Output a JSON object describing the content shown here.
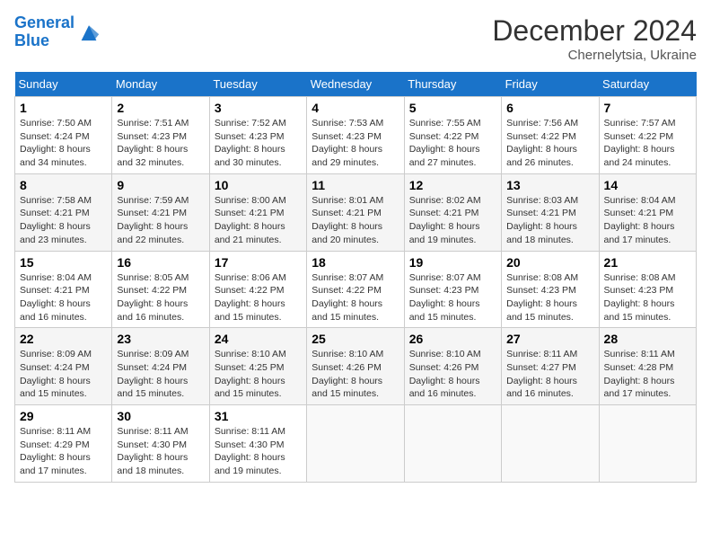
{
  "logo": {
    "line1": "General",
    "line2": "Blue"
  },
  "title": "December 2024",
  "location": "Chernelytsia, Ukraine",
  "days_of_week": [
    "Sunday",
    "Monday",
    "Tuesday",
    "Wednesday",
    "Thursday",
    "Friday",
    "Saturday"
  ],
  "weeks": [
    [
      {
        "day": 1,
        "sunrise": "7:50 AM",
        "sunset": "4:24 PM",
        "daylight": "8 hours and 34 minutes."
      },
      {
        "day": 2,
        "sunrise": "7:51 AM",
        "sunset": "4:23 PM",
        "daylight": "8 hours and 32 minutes."
      },
      {
        "day": 3,
        "sunrise": "7:52 AM",
        "sunset": "4:23 PM",
        "daylight": "8 hours and 30 minutes."
      },
      {
        "day": 4,
        "sunrise": "7:53 AM",
        "sunset": "4:23 PM",
        "daylight": "8 hours and 29 minutes."
      },
      {
        "day": 5,
        "sunrise": "7:55 AM",
        "sunset": "4:22 PM",
        "daylight": "8 hours and 27 minutes."
      },
      {
        "day": 6,
        "sunrise": "7:56 AM",
        "sunset": "4:22 PM",
        "daylight": "8 hours and 26 minutes."
      },
      {
        "day": 7,
        "sunrise": "7:57 AM",
        "sunset": "4:22 PM",
        "daylight": "8 hours and 24 minutes."
      }
    ],
    [
      {
        "day": 8,
        "sunrise": "7:58 AM",
        "sunset": "4:21 PM",
        "daylight": "8 hours and 23 minutes."
      },
      {
        "day": 9,
        "sunrise": "7:59 AM",
        "sunset": "4:21 PM",
        "daylight": "8 hours and 22 minutes."
      },
      {
        "day": 10,
        "sunrise": "8:00 AM",
        "sunset": "4:21 PM",
        "daylight": "8 hours and 21 minutes."
      },
      {
        "day": 11,
        "sunrise": "8:01 AM",
        "sunset": "4:21 PM",
        "daylight": "8 hours and 20 minutes."
      },
      {
        "day": 12,
        "sunrise": "8:02 AM",
        "sunset": "4:21 PM",
        "daylight": "8 hours and 19 minutes."
      },
      {
        "day": 13,
        "sunrise": "8:03 AM",
        "sunset": "4:21 PM",
        "daylight": "8 hours and 18 minutes."
      },
      {
        "day": 14,
        "sunrise": "8:04 AM",
        "sunset": "4:21 PM",
        "daylight": "8 hours and 17 minutes."
      }
    ],
    [
      {
        "day": 15,
        "sunrise": "8:04 AM",
        "sunset": "4:21 PM",
        "daylight": "8 hours and 16 minutes."
      },
      {
        "day": 16,
        "sunrise": "8:05 AM",
        "sunset": "4:22 PM",
        "daylight": "8 hours and 16 minutes."
      },
      {
        "day": 17,
        "sunrise": "8:06 AM",
        "sunset": "4:22 PM",
        "daylight": "8 hours and 15 minutes."
      },
      {
        "day": 18,
        "sunrise": "8:07 AM",
        "sunset": "4:22 PM",
        "daylight": "8 hours and 15 minutes."
      },
      {
        "day": 19,
        "sunrise": "8:07 AM",
        "sunset": "4:23 PM",
        "daylight": "8 hours and 15 minutes."
      },
      {
        "day": 20,
        "sunrise": "8:08 AM",
        "sunset": "4:23 PM",
        "daylight": "8 hours and 15 minutes."
      },
      {
        "day": 21,
        "sunrise": "8:08 AM",
        "sunset": "4:23 PM",
        "daylight": "8 hours and 15 minutes."
      }
    ],
    [
      {
        "day": 22,
        "sunrise": "8:09 AM",
        "sunset": "4:24 PM",
        "daylight": "8 hours and 15 minutes."
      },
      {
        "day": 23,
        "sunrise": "8:09 AM",
        "sunset": "4:24 PM",
        "daylight": "8 hours and 15 minutes."
      },
      {
        "day": 24,
        "sunrise": "8:10 AM",
        "sunset": "4:25 PM",
        "daylight": "8 hours and 15 minutes."
      },
      {
        "day": 25,
        "sunrise": "8:10 AM",
        "sunset": "4:26 PM",
        "daylight": "8 hours and 15 minutes."
      },
      {
        "day": 26,
        "sunrise": "8:10 AM",
        "sunset": "4:26 PM",
        "daylight": "8 hours and 16 minutes."
      },
      {
        "day": 27,
        "sunrise": "8:11 AM",
        "sunset": "4:27 PM",
        "daylight": "8 hours and 16 minutes."
      },
      {
        "day": 28,
        "sunrise": "8:11 AM",
        "sunset": "4:28 PM",
        "daylight": "8 hours and 17 minutes."
      }
    ],
    [
      {
        "day": 29,
        "sunrise": "8:11 AM",
        "sunset": "4:29 PM",
        "daylight": "8 hours and 17 minutes."
      },
      {
        "day": 30,
        "sunrise": "8:11 AM",
        "sunset": "4:30 PM",
        "daylight": "8 hours and 18 minutes."
      },
      {
        "day": 31,
        "sunrise": "8:11 AM",
        "sunset": "4:30 PM",
        "daylight": "8 hours and 19 minutes."
      },
      null,
      null,
      null,
      null
    ]
  ]
}
